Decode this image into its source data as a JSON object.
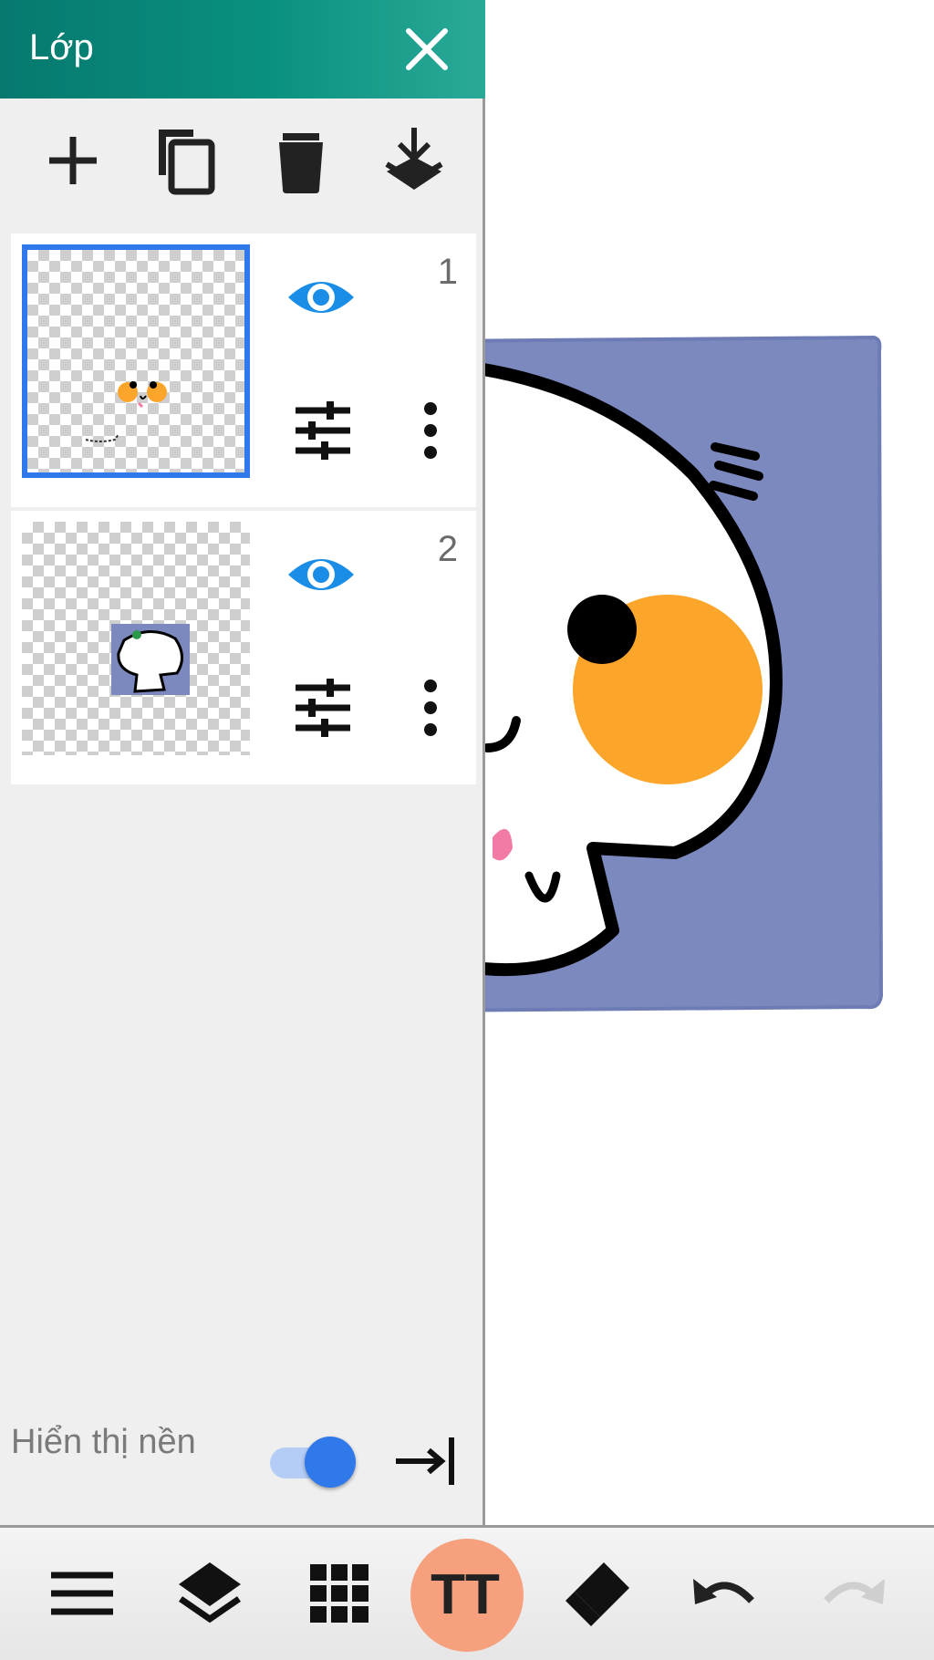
{
  "panel": {
    "title": "Lớp",
    "header_gradient": [
      "#06796f",
      "#2aa997"
    ],
    "toolbar_icons": [
      "plus-icon",
      "duplicate-icon",
      "trash-icon",
      "merge-down-icon"
    ],
    "layers": [
      {
        "number": "1",
        "selected": true,
        "visible": true
      },
      {
        "number": "2",
        "selected": false,
        "visible": true
      }
    ],
    "show_background": {
      "label": "Hiển thị nền",
      "on": true
    }
  },
  "colors": {
    "accent_blue": "#2f79ea",
    "eye_blue": "#1a8ee6",
    "artwork_background": "#7b89bf",
    "cheek_orange": "#fca52b",
    "text_tool_highlight": "#f6a07d"
  },
  "bottom_toolbar": {
    "icons": [
      "menu-icon",
      "layers-icon",
      "grid-icon",
      "text-tool-icon",
      "eraser-icon",
      "undo-icon",
      "redo-icon"
    ],
    "active": "text-tool-icon",
    "text_tool_glyph": "TT"
  }
}
